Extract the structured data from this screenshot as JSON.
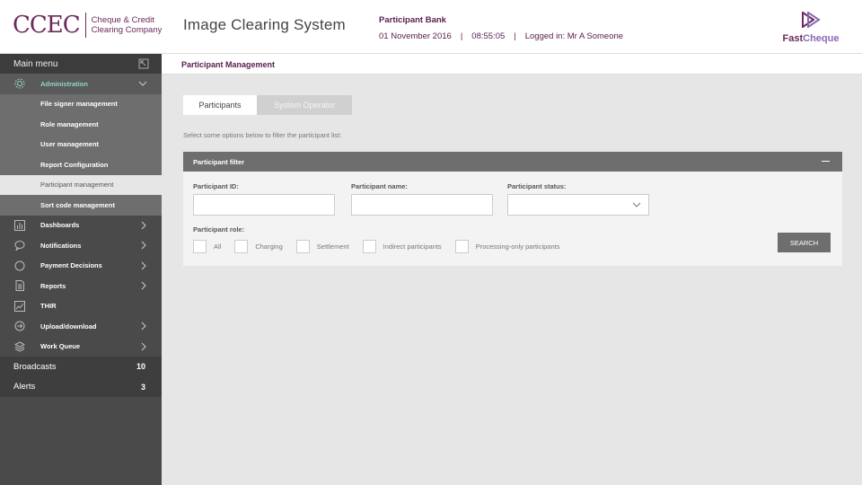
{
  "header": {
    "logo_mark": "CCEC",
    "logo_line1": "Cheque & Credit",
    "logo_line2": "Clearing Company",
    "app_title": "Image Clearing System",
    "bank_name": "Participant Bank",
    "date": "01 November 2016",
    "sep1": "|",
    "time": "08:55:05",
    "sep2": "|",
    "logged_in": "Logged in: Mr A Someone",
    "fc_bold": "Fast",
    "fc_light": "Cheque"
  },
  "sidebar": {
    "main_menu": "Main menu",
    "admin": {
      "label": "Administration",
      "icon": "gear-icon"
    },
    "admin_items": [
      {
        "label": "File signer management"
      },
      {
        "label": "Role management"
      },
      {
        "label": "User management"
      },
      {
        "label": "Report Configuration"
      },
      {
        "label": "Participant management"
      },
      {
        "label": "Sort code management"
      }
    ],
    "items": [
      {
        "label": "Dashboards",
        "icon": "bar-chart-icon"
      },
      {
        "label": "Notifications",
        "icon": "speech-bubble-icon"
      },
      {
        "label": "Payment Decisions",
        "icon": "circle-icon"
      },
      {
        "label": "Reports",
        "icon": "document-icon"
      },
      {
        "label": "THIR",
        "icon": "line-chart-icon"
      },
      {
        "label": "Upload/download",
        "icon": "arrow-circle-icon"
      },
      {
        "label": "Work Queue",
        "icon": "layers-icon"
      }
    ],
    "broadcasts": {
      "label": "Broadcasts",
      "count": "10"
    },
    "alerts": {
      "label": "Alerts",
      "count": "3"
    }
  },
  "breadcrumb": "Participant Management",
  "tabs": [
    {
      "label": "Participants",
      "active": true
    },
    {
      "label": "System Operator",
      "active": false
    }
  ],
  "hint": "Select some options below to filter the participant list:",
  "filter": {
    "title": "Participant filter",
    "id_label": "Participant ID:",
    "id_value": "",
    "name_label": "Participant name:",
    "name_value": "",
    "status_label": "Participant status:",
    "status_value": "",
    "role_label": "Participant role:",
    "roles": [
      "All",
      "Charging",
      "Settlement",
      "Indirect participants",
      "Processing-only participants"
    ],
    "search_label": "SEARCH"
  },
  "colors": {
    "brand": "#6b2a5a",
    "accent": "#8fd6c8",
    "sidebar": "#4a4a4a"
  }
}
